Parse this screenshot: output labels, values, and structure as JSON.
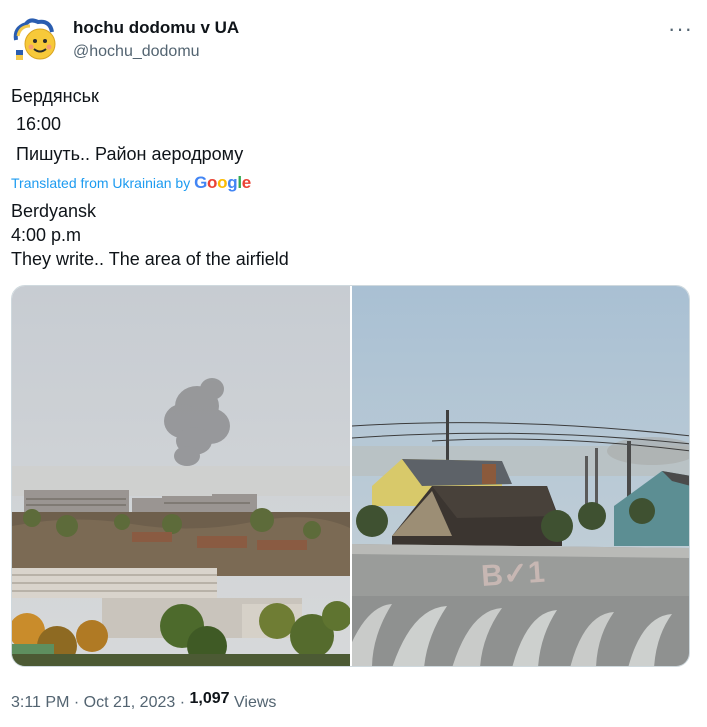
{
  "author": {
    "display_name": "hochu dodomu v UA",
    "handle": "@hochu_dodomu"
  },
  "tweet": {
    "original_lines": [
      "Бердянськ",
      " 16:00",
      " Пишуть.. Район аеродрому"
    ],
    "translation_label": "Translated from Ukrainian by",
    "translation_provider": "Google",
    "translated_lines": [
      "Berdyansk",
      "4:00 p.m",
      "They write.. The area of the airfield"
    ]
  },
  "media": {
    "photos": [
      {
        "subject": "smoke over city buildings"
      },
      {
        "subject": "smoke beyond rooftops",
        "roof_graffiti": "B✓1"
      }
    ]
  },
  "footer": {
    "time": "3:11 PM",
    "separator": "·",
    "date": "Oct 21, 2023",
    "views_count": "1,097",
    "views_label": "Views"
  },
  "icons": {
    "more": "more-horizontal-icon",
    "avatar": "avatar-emoji-icon"
  },
  "colors": {
    "link_blue": "#1d9bf0",
    "secondary_text": "#536471"
  }
}
